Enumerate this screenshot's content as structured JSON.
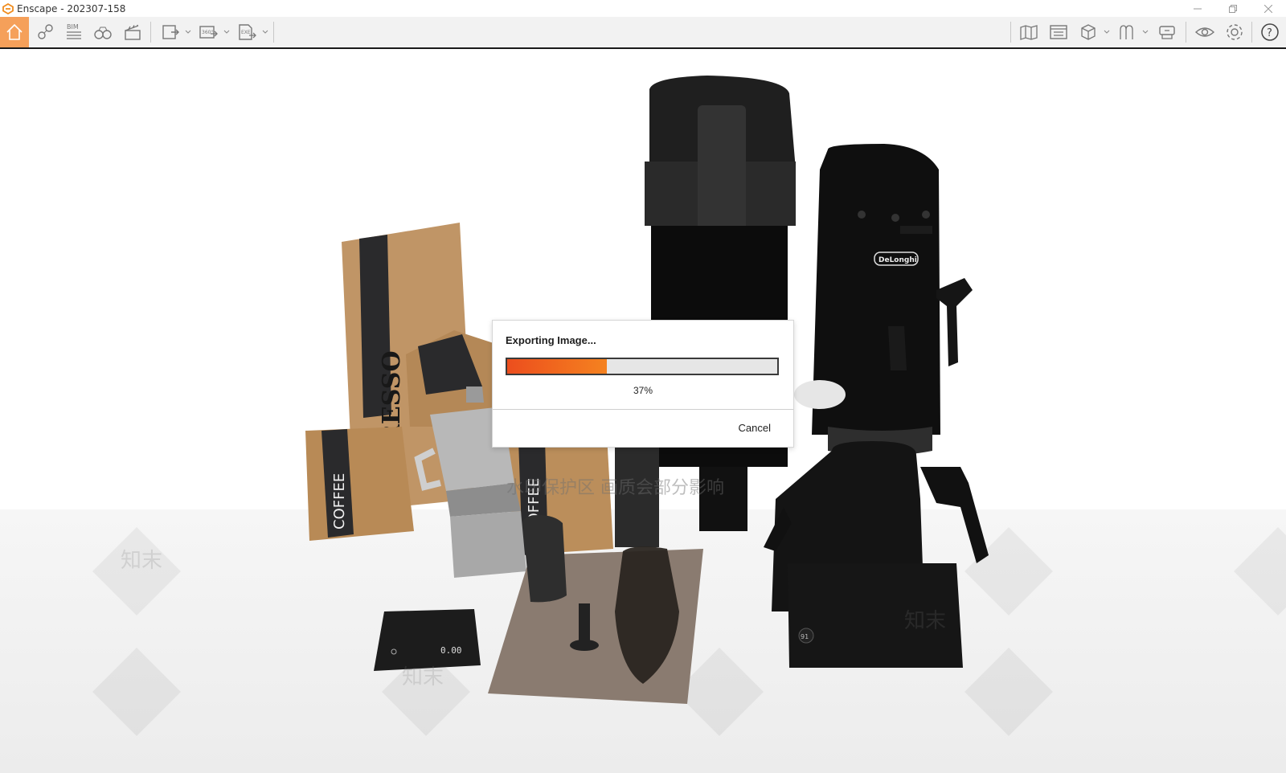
{
  "window": {
    "title": "Enscape - 202307-158",
    "minimize_icon": "minimize-icon",
    "restore_icon": "restore-icon",
    "close_icon": "close-icon"
  },
  "toolbar": {
    "left": [
      {
        "name": "home-icon",
        "active": true
      },
      {
        "name": "views-icon"
      },
      {
        "name": "bim-icon",
        "label": "BIM"
      },
      {
        "name": "binoculars-icon"
      },
      {
        "name": "clapperboard-icon"
      }
    ],
    "export": [
      {
        "name": "render-image-icon"
      },
      {
        "name": "panorama-icon",
        "label": "360°"
      },
      {
        "name": "exe-export-icon",
        "label": "EXE"
      }
    ],
    "right": [
      {
        "name": "map-icon"
      },
      {
        "name": "asset-library-icon"
      },
      {
        "name": "cube-icon"
      },
      {
        "name": "material-editor-icon"
      },
      {
        "name": "cloud-upload-icon"
      },
      {
        "name": "eye-icon"
      },
      {
        "name": "settings-icon"
      },
      {
        "name": "help-icon",
        "label": "?"
      }
    ],
    "accent": "#f5a05a"
  },
  "scene": {
    "watermark": "水印保护区 画质会部分影响",
    "watermark_logo": "知末",
    "bag_text_1": "RESSO",
    "bag_text_2": "COFFEE",
    "bag_text_3": "COFFEE",
    "brand": "DeLonghi",
    "scale_display": "0.00",
    "kettle_display": "91"
  },
  "dialog": {
    "title": "Exporting Image...",
    "progress": 0.37,
    "progress_text": "37%",
    "cancel_label": "Cancel",
    "colors": {
      "fill_start": "#ec4e1e",
      "fill_end": "#f5821f"
    }
  }
}
